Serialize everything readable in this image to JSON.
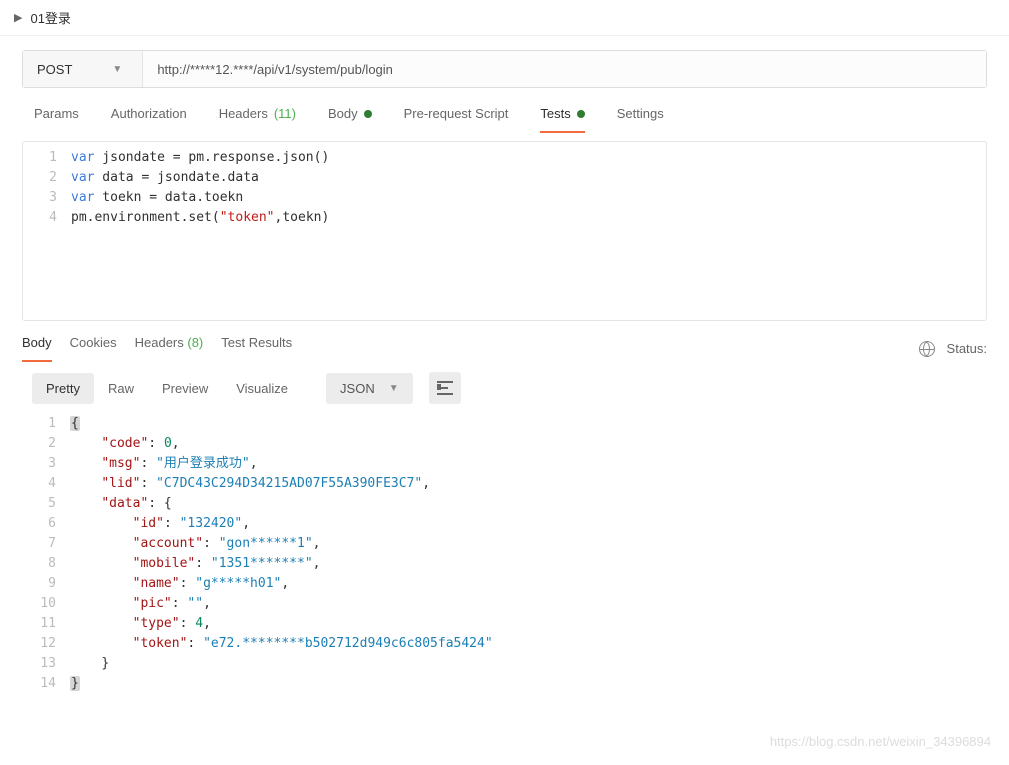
{
  "header": {
    "title": "01登录"
  },
  "request": {
    "method": "POST",
    "url": "http://*****12.****/api/v1/system/pub/login"
  },
  "reqTabs": {
    "params": "Params",
    "auth": "Authorization",
    "headers": "Headers",
    "headers_count": "(11)",
    "body": "Body",
    "prereq": "Pre-request Script",
    "tests": "Tests",
    "settings": "Settings"
  },
  "editor": {
    "l1a": "var",
    "l1b": " jsondate = pm.response.json()",
    "l2a": "var",
    "l2b": " data = jsondate.data",
    "l3a": "var",
    "l3b": " toekn = data.toekn",
    "l4a": "pm.environment.set(",
    "l4b": "\"token\"",
    "l4c": ",toekn)"
  },
  "respTabs": {
    "body": "Body",
    "cookies": "Cookies",
    "headers": "Headers",
    "headers_count": "(8)",
    "tests": "Test Results",
    "status_label": "Status:"
  },
  "viewTabs": {
    "pretty": "Pretty",
    "raw": "Raw",
    "preview": "Preview",
    "visualize": "Visualize",
    "lang": "JSON"
  },
  "json": {
    "open": "{",
    "code_k": "\"code\"",
    "code_v": "0",
    "msg_k": "\"msg\"",
    "msg_v": "\"用户登录成功\"",
    "lid_k": "\"lid\"",
    "lid_v": "\"C7DC43C294D34215AD07F55A390FE3C7\"",
    "data_k": "\"data\"",
    "id_k": "\"id\"",
    "id_v": "\"132420\"",
    "acc_k": "\"account\"",
    "acc_v": "\"gon******1\"",
    "mob_k": "\"mobile\"",
    "mob_v": "\"1351*******\"",
    "name_k": "\"name\"",
    "name_v": "\"g*****h01\"",
    "pic_k": "\"pic\"",
    "pic_v": "\"\"",
    "type_k": "\"type\"",
    "type_v": "4",
    "tok_k": "\"token\"",
    "tok_v": "\"e72.********b502712d949c6c805fa5424\"",
    "close_in": "}",
    "close": "}"
  },
  "watermark": "https://blog.csdn.net/weixin_34396894"
}
